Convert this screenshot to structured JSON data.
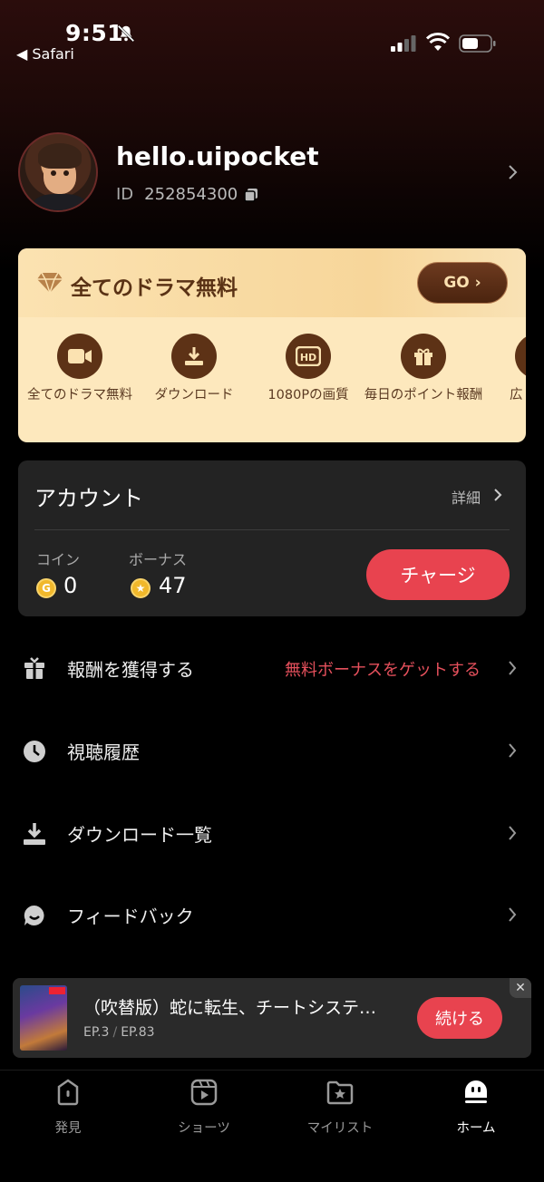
{
  "status_bar": {
    "time": "9:51",
    "back_app": "◀ Safari"
  },
  "profile": {
    "username": "hello.uipocket",
    "id_label": "ID",
    "id_value": "252854300"
  },
  "vip_card": {
    "title": "全てのドラマ無料",
    "go_label": "GO ›",
    "perks": [
      {
        "icon": "video-icon",
        "label": "全てのドラマ無料"
      },
      {
        "icon": "download-icon",
        "label": "ダウンロード"
      },
      {
        "icon": "hd-icon",
        "label": "1080Pの画質"
      },
      {
        "icon": "gift-icon",
        "label": "毎日のポイント報酬"
      },
      {
        "icon": "ad-icon",
        "label": "広"
      }
    ]
  },
  "account": {
    "title": "アカウント",
    "detail_label": "詳細",
    "coin_label": "コイン",
    "coin_value": "0",
    "bonus_label": "ボーナス",
    "bonus_value": "47",
    "charge_label": "チャージ"
  },
  "menu": [
    {
      "icon": "gift-box-icon",
      "label": "報酬を獲得する",
      "extra": "無料ボーナスをゲットする"
    },
    {
      "icon": "clock-icon",
      "label": "視聴履歴",
      "extra": ""
    },
    {
      "icon": "download-icon",
      "label": "ダウンロード一覧",
      "extra": ""
    },
    {
      "icon": "chat-icon",
      "label": "フィードバック",
      "extra": ""
    }
  ],
  "continue_watching": {
    "title": "（吹替版）蛇に転生、チートシステ…",
    "episode_current": "EP.3",
    "episode_total": "EP.83",
    "button_label": "続ける",
    "close_label": "✕"
  },
  "tabbar": [
    {
      "icon": "discover-icon",
      "label": "発見",
      "active": false
    },
    {
      "icon": "shorts-icon",
      "label": "ショーツ",
      "active": false
    },
    {
      "icon": "mylist-icon",
      "label": "マイリスト",
      "active": false
    },
    {
      "icon": "home-icon",
      "label": "ホーム",
      "active": true
    }
  ],
  "colors": {
    "accent": "#e8434f",
    "vip_bg": "#fde8bd",
    "vip_text": "#5a3215",
    "card_bg": "#232323"
  }
}
